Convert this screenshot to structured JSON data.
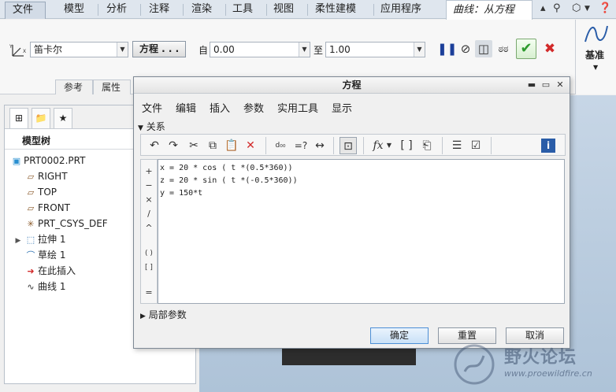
{
  "menubar": {
    "file": "文件",
    "tabs": [
      "模型",
      "分析",
      "注释",
      "渲染",
      "工具",
      "视图",
      "柔性建模",
      "应用程序"
    ],
    "active_tab": "曲线：从方程"
  },
  "ribbon": {
    "csys_label": "笛卡尔",
    "equation_button": "方程 . . .",
    "from_label": "自",
    "from_value": "0.00",
    "to_label": "至",
    "to_value": "1.00",
    "datum_label": "基准",
    "subtabs": [
      "参考",
      "属性"
    ]
  },
  "model_tree": {
    "title": "模型树",
    "items": [
      {
        "label": "PRT0002.PRT",
        "icon": "part-icon"
      },
      {
        "label": "RIGHT",
        "icon": "datum-plane-icon"
      },
      {
        "label": "TOP",
        "icon": "datum-plane-icon"
      },
      {
        "label": "FRONT",
        "icon": "datum-plane-icon"
      },
      {
        "label": "PRT_CSYS_DEF",
        "icon": "csys-icon"
      },
      {
        "label": "拉伸 1",
        "icon": "extrude-icon"
      },
      {
        "label": "草绘 1",
        "icon": "sketch-icon"
      },
      {
        "label": "在此插入",
        "icon": "insert-arrow-icon"
      },
      {
        "label": "曲线 1",
        "icon": "curve-icon"
      }
    ]
  },
  "dialog": {
    "title": "方程",
    "menu": [
      "文件",
      "编辑",
      "插入",
      "参数",
      "实用工具",
      "显示"
    ],
    "relations_header": "关系",
    "operators": [
      "+",
      "−",
      "×",
      "/",
      "^",
      "( )",
      "[ ]",
      "="
    ],
    "equations": [
      "x = 20 * cos ( t *(0.5*360))",
      "z = 20 * sin ( t *(-0.5*360))",
      "y = 150*t"
    ],
    "local_params_header": "局部参数",
    "ok": "确定",
    "reset": "重置",
    "cancel": "取消"
  },
  "watermark": {
    "text": "野火论坛",
    "url": "www.proewildfire.cn"
  },
  "colors": {
    "accept": "#2e9b2e",
    "cancel": "#d22a2a",
    "ok_border": "#4c8fd6"
  }
}
